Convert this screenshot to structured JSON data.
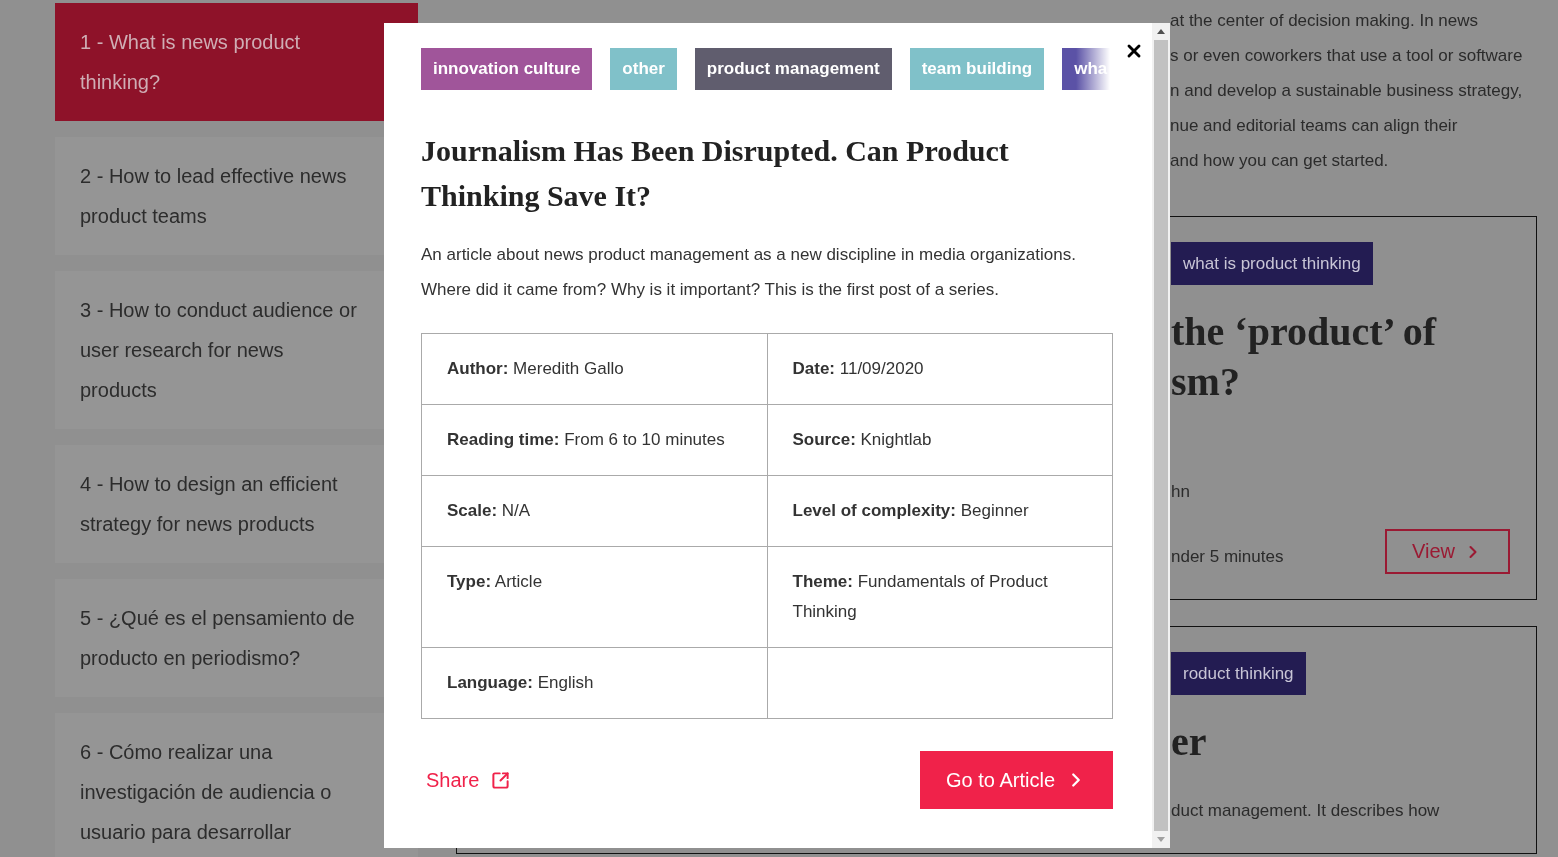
{
  "sidebar": {
    "items": [
      {
        "label": "1 - What is news product thinking?",
        "selected": true
      },
      {
        "label": "2 - How to lead effective news product teams",
        "selected": false
      },
      {
        "label": "3 - How to conduct audience or user research for news products",
        "selected": false
      },
      {
        "label": "4 - How to design an efficient strategy for news products",
        "selected": false
      },
      {
        "label": "5 - ¿Qué es el pensamiento de producto en periodismo?",
        "selected": false
      },
      {
        "label": "6 - Cómo realizar una investigación de audiencia o usuario para desarrollar",
        "selected": false
      }
    ]
  },
  "background": {
    "intro_lines": [
      {
        "kind": "fragment",
        "text": "at the center of decision making. In news"
      },
      {
        "kind": "fragment",
        "text": "s or even coworkers that use a tool or software"
      },
      {
        "kind": "fragment",
        "text": "n and develop a sustainable business strategy,"
      },
      {
        "kind": "fragment",
        "text": "nue and editorial teams can align their"
      },
      {
        "kind": "fragment",
        "text": "and how you can get started."
      }
    ],
    "cards": [
      {
        "tag": "what is product thinking",
        "heading_lines": [
          "the ‘product’ of",
          "sm?"
        ],
        "lines": [
          {
            "kind": "meta",
            "text": "hn"
          },
          {
            "kind": "meta",
            "text": "nder 5 minutes"
          }
        ],
        "button": "View"
      },
      {
        "tag": "roduct thinking",
        "heading_lines": [
          "er"
        ],
        "lines": [
          {
            "kind": "fragment",
            "text": "duct management. It describes how"
          }
        ]
      }
    ]
  },
  "modal": {
    "tags": [
      {
        "label": "innovation culture",
        "color": "#a0559a"
      },
      {
        "label": "other",
        "color": "#80c1c9"
      },
      {
        "label": "product management",
        "color": "#605d6e"
      },
      {
        "label": "team building",
        "color": "#80c1c9"
      },
      {
        "label": "wha",
        "color": "#5b52a6"
      }
    ],
    "title": "Journalism Has Been Disrupted. Can Product Thinking Save It?",
    "description": "An article about news product management as a new discipline in media organizations. Where did it came from? Why is it important? This is the first post of a series.",
    "details": [
      "**Author:** Meredith Gallo",
      "**Date:** 11/09/2020",
      "**Reading time:** From 6 to 10 minutes",
      "**Source:** Knightlab",
      "**Scale:** N/A",
      "**Level of complexity:** Beginner",
      "**Type:** Article",
      "**Theme:** Fundamentals of Product Thinking",
      "**Language:** English"
    ],
    "share": "Share",
    "button": "Go to Article"
  }
}
